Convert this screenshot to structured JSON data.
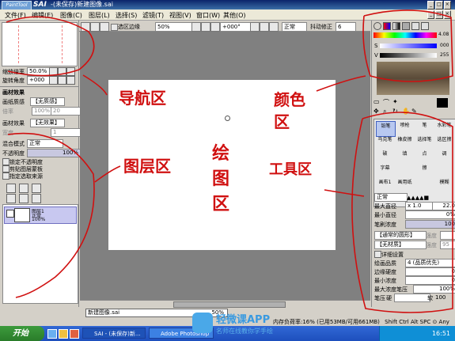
{
  "app": {
    "logo_text": "PaintTool",
    "name": "SAI",
    "title": "-(未保存)新建图像.sai"
  },
  "window_controls": [
    "_",
    "□",
    "×"
  ],
  "menu": [
    "文件(F)",
    "编辑(E)",
    "图像(C)",
    "图层(L)",
    "选择(S)",
    "滤镜(T)",
    "视图(V)",
    "窗口(W)",
    "其他(O)"
  ],
  "toolbar": {
    "selection_edge_label": "选区边缘",
    "zoom": "50%",
    "rotation": "+000°",
    "blend_mode": "正常",
    "stabilizer_label": "抖动修正",
    "stabilizer_value": "6"
  },
  "navigator": {
    "zoom_label": "缩放倍率",
    "zoom_value": "50.0%",
    "rotate_label": "旋转角度",
    "rotate_value": "+000"
  },
  "layer_panel": {
    "header": "画材效果",
    "texture_label": "画纸质感",
    "texture_value": "【无质感】",
    "scale_label": "倍率",
    "scale_value": "100%",
    "strength_label": "强度",
    "strength_value": "20",
    "effect_label": "画材效果",
    "effect_value": "【无效果】",
    "width_label": "宽度",
    "width_value": "1",
    "blend_label": "混合模式",
    "blend_value": "正常",
    "opacity_label": "不透明度",
    "opacity_value": "100%",
    "lock_opacity": "锁定不透明度",
    "clip_group": "剪贴图层蒙板",
    "selection_source": "指定选取来源",
    "layer_name": "图层1",
    "layer_mode": "正常",
    "layer_opacity": "100%"
  },
  "color_panel": {
    "h_value": "0",
    "s_value": "000",
    "v_value": "255",
    "h_label": "H",
    "s_label": "S",
    "v_label": "V",
    "end_value": "4.08"
  },
  "tool_panel": {
    "brushes": [
      "铅笔",
      "喷枪",
      "笔",
      "水彩笔",
      "马克笔",
      "橡皮擦",
      "选择笔",
      "选区擦",
      "破",
      "填",
      "点",
      "调",
      "字幕",
      "",
      "擦",
      "",
      "画布1",
      "画用纸",
      "",
      "模糊",
      "",
      "",
      "",
      ""
    ],
    "mode_value": "正常",
    "max_size_label": "最大直径",
    "max_size_mult": "x 1.0",
    "max_size_value": "22.0",
    "min_size_label": "最小直径",
    "min_size_value": "0%",
    "density_label": "笔刷浓度",
    "density_value": "100",
    "shape_value": "【通常的圆形】",
    "shape_strength_label": "强度",
    "shape_strength_value": "",
    "texture_value": "【无材质】",
    "texture_strength_label": "强度",
    "texture_strength_value": "95",
    "advanced_label": "详细设置",
    "quality_label": "绘画品质",
    "quality_value": "4 (品质优先)",
    "edge_label": "边缘硬度",
    "edge_value": "0",
    "min_density_label": "最小浓度",
    "min_density_value": "0",
    "max_pressure_label": "最大浓度笔压",
    "max_pressure_value": "100%",
    "pressure_label": "笔压",
    "pressure_hard": "硬",
    "pressure_soft": "软",
    "pressure_value": "100",
    "pressure_density": "浓度",
    "pressure_size": "直径"
  },
  "canvas": {
    "doc_tab_name": "新建图像.sai",
    "doc_tab_zoom": "50%"
  },
  "status": {
    "memory": "内存负荷率:16% (已用53MB/可用661MB)",
    "keys": "Shift Ctrl Alt SPC ⊙ Any"
  },
  "taskbar": {
    "start": "开始",
    "tasks": [
      "SAI - (未保存)新...",
      "Adobe Photoshop"
    ],
    "clock": "16:51"
  },
  "annotations": {
    "navigator": "导航区",
    "color": "颜色区",
    "layers": "图层区",
    "drawing": "绘图区",
    "tools": "工具区"
  },
  "watermark": {
    "app_name": "轻微课APP",
    "subtitle": "名师在线教你学手绘"
  },
  "colors": {
    "annotation": "#d01010",
    "canvas_bg": "#808080",
    "panel": "#d4d0c8",
    "taskbar": "#2458d0"
  }
}
